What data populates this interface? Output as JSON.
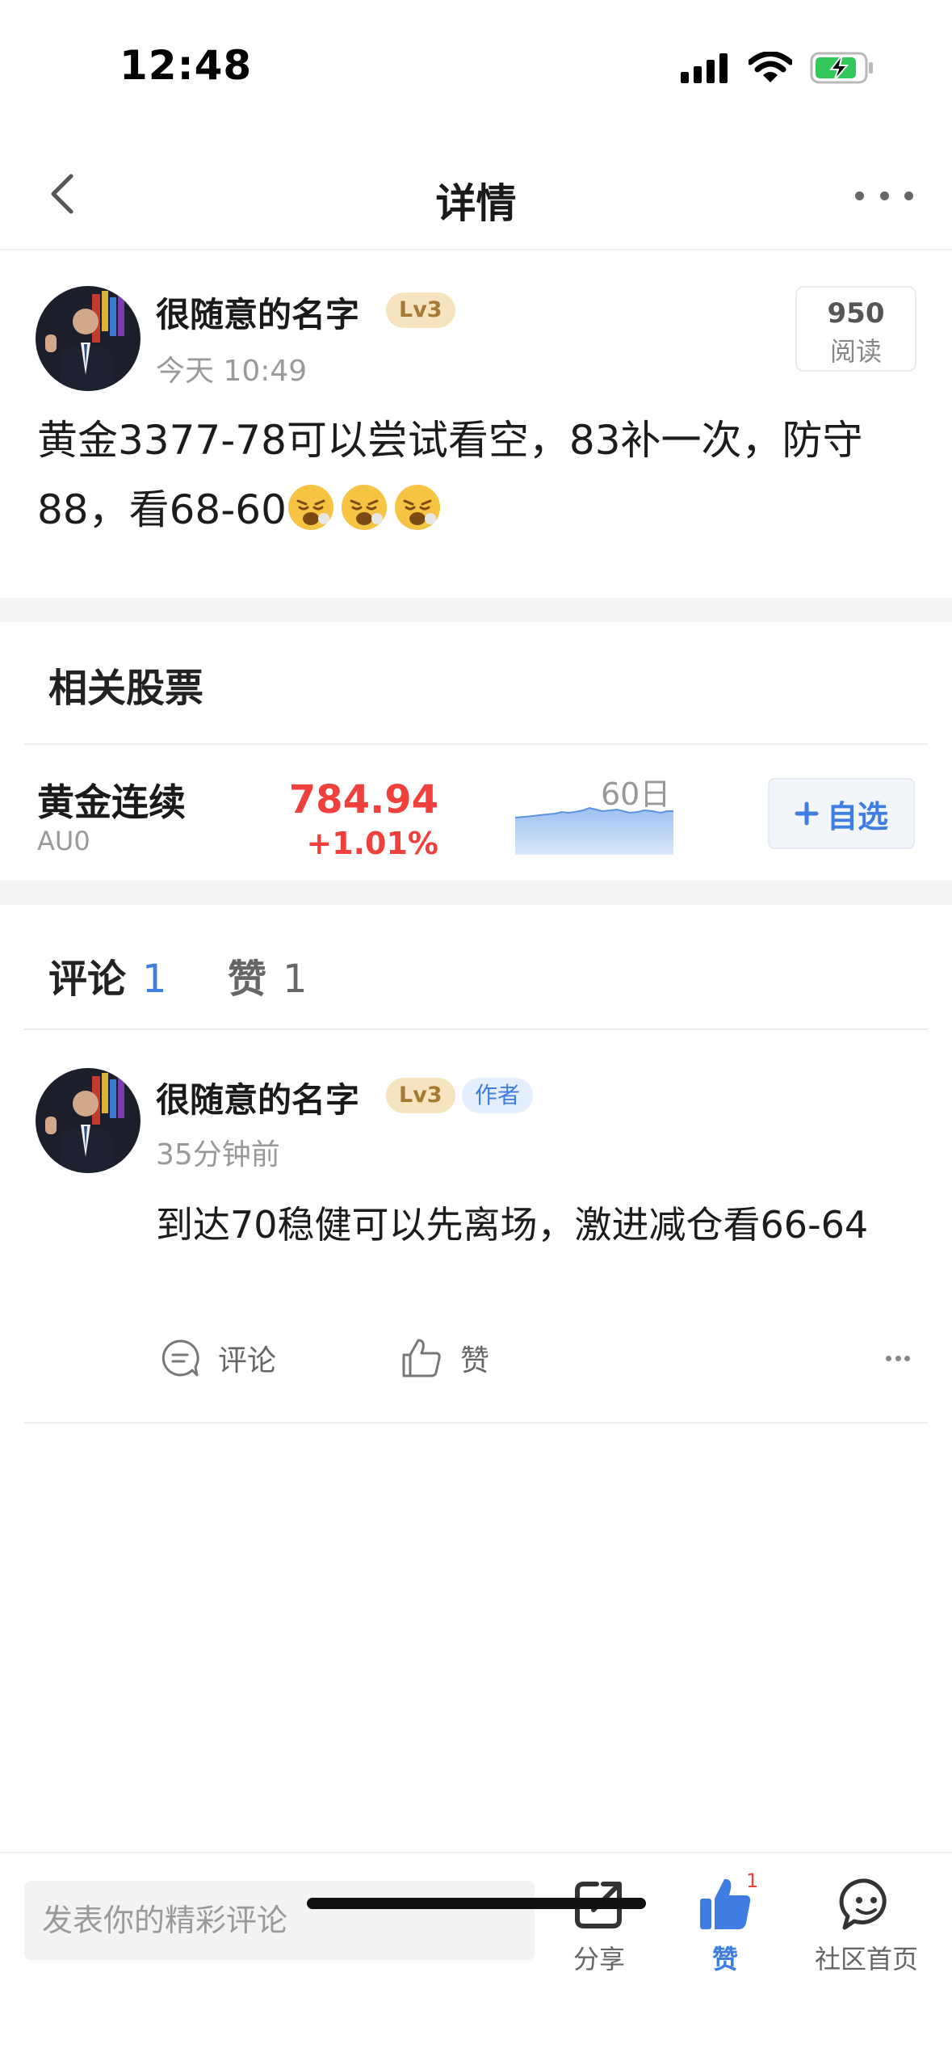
{
  "status_bar": {
    "time": "12:48"
  },
  "nav": {
    "title": "详情"
  },
  "post": {
    "author": "很随意的名字",
    "level": "Lv3",
    "time": "今天 10:49",
    "read_count": "950",
    "read_label": "阅读",
    "content": "黄金3377-78可以尝试看空，83补一次，防守88，看68-60"
  },
  "related": {
    "title": "相关股票",
    "stock": {
      "name": "黄金连续",
      "code": "AU0",
      "price": "784.94",
      "change": "+1.01%",
      "period": "60日",
      "watch_label": "自选",
      "price_color": "#f0403c"
    }
  },
  "tabs": {
    "comments_label": "评论",
    "comments_count": "1",
    "likes_label": "赞",
    "likes_count": "1"
  },
  "comment": {
    "author": "很随意的名字",
    "level": "Lv3",
    "author_badge": "作者",
    "time": "35分钟前",
    "text": "到达70稳健可以先离场，激进减仓看66-64",
    "reply_label": "评论",
    "like_label": "赞"
  },
  "bottom_bar": {
    "input_placeholder": "发表你的精彩评论",
    "share_label": "分享",
    "like_label": "赞",
    "like_count": "1",
    "community_label": "社区首页"
  },
  "colors": {
    "accent": "#3f7de3",
    "up": "#f0403c",
    "badge_gold": "#f6e3bf"
  }
}
